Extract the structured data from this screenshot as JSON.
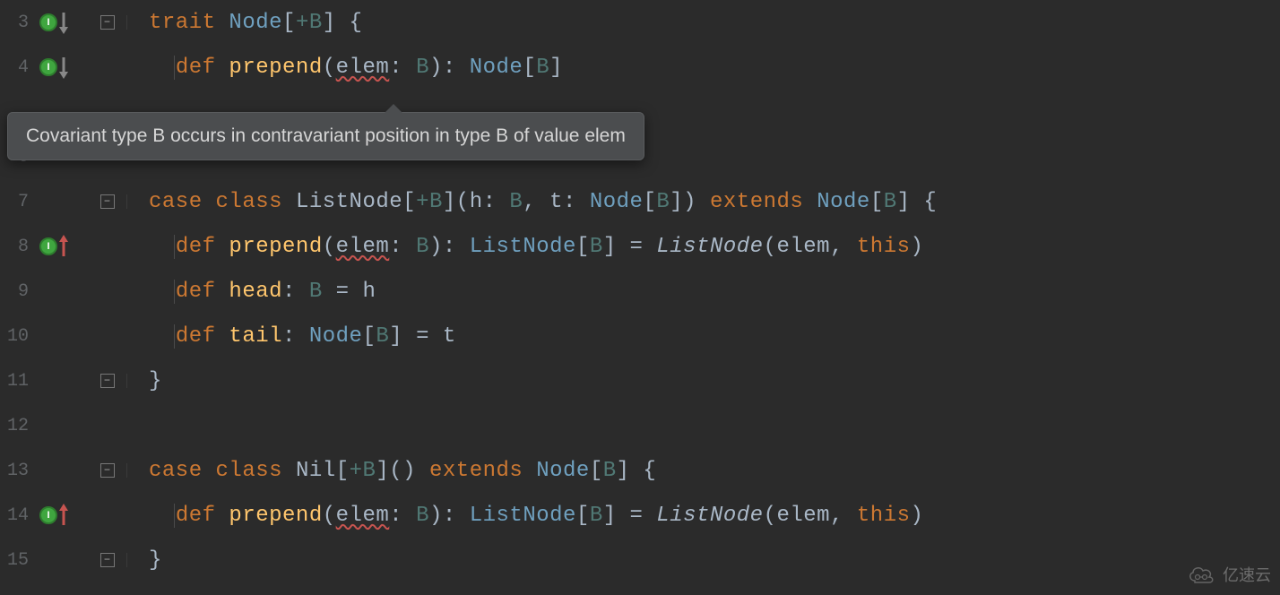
{
  "tooltip": {
    "text": "Covariant type B occurs in contravariant position in type B of value elem"
  },
  "lines": [
    {
      "num": "3",
      "icon": "impl-down",
      "fold": "open",
      "code": {
        "segments": [
          {
            "t": "trait ",
            "c": "kw"
          },
          {
            "t": "Node",
            "c": "ty"
          },
          {
            "t": "[",
            "c": "par"
          },
          {
            "t": "+B",
            "c": "tv"
          },
          {
            "t": "] {",
            "c": "par"
          }
        ]
      },
      "indent": 0
    },
    {
      "num": "4",
      "icon": "impl-down",
      "fold": "",
      "code": {
        "segments": [
          {
            "t": "  ",
            "c": ""
          },
          {
            "t": "def ",
            "c": "kw"
          },
          {
            "t": "prepend",
            "c": "fn"
          },
          {
            "t": "(",
            "c": "par"
          },
          {
            "t": "elem",
            "c": "id",
            "err": true
          },
          {
            "t": ": ",
            "c": "par"
          },
          {
            "t": "B",
            "c": "tv"
          },
          {
            "t": "): ",
            "c": "par"
          },
          {
            "t": "Node",
            "c": "ty"
          },
          {
            "t": "[",
            "c": "par"
          },
          {
            "t": "B",
            "c": "tv"
          },
          {
            "t": "]",
            "c": "par"
          }
        ]
      },
      "indent": 1
    },
    {
      "num": "",
      "icon": "",
      "fold": "",
      "code": {
        "segments": []
      },
      "indent": 0,
      "hidden": true
    },
    {
      "num": "6",
      "icon": "",
      "fold": "",
      "code": {
        "segments": []
      },
      "indent": 0
    },
    {
      "num": "7",
      "icon": "",
      "fold": "open",
      "code": {
        "segments": [
          {
            "t": "case class ",
            "c": "kw"
          },
          {
            "t": "ListNode",
            "c": "cls"
          },
          {
            "t": "[",
            "c": "par"
          },
          {
            "t": "+B",
            "c": "tv"
          },
          {
            "t": "](",
            "c": "par"
          },
          {
            "t": "h",
            "c": "id"
          },
          {
            "t": ": ",
            "c": "par"
          },
          {
            "t": "B",
            "c": "tv"
          },
          {
            "t": ", ",
            "c": "par"
          },
          {
            "t": "t",
            "c": "id"
          },
          {
            "t": ": ",
            "c": "par"
          },
          {
            "t": "Node",
            "c": "ty"
          },
          {
            "t": "[",
            "c": "par"
          },
          {
            "t": "B",
            "c": "tv"
          },
          {
            "t": "]) ",
            "c": "par"
          },
          {
            "t": "extends ",
            "c": "kw"
          },
          {
            "t": "Node",
            "c": "ty"
          },
          {
            "t": "[",
            "c": "par"
          },
          {
            "t": "B",
            "c": "tv"
          },
          {
            "t": "] {",
            "c": "par"
          }
        ]
      },
      "indent": 0
    },
    {
      "num": "8",
      "icon": "impl-up",
      "fold": "",
      "code": {
        "segments": [
          {
            "t": "  ",
            "c": ""
          },
          {
            "t": "def ",
            "c": "kw"
          },
          {
            "t": "prepend",
            "c": "fn"
          },
          {
            "t": "(",
            "c": "par"
          },
          {
            "t": "elem",
            "c": "id",
            "err": true
          },
          {
            "t": ": ",
            "c": "par"
          },
          {
            "t": "B",
            "c": "tv"
          },
          {
            "t": "): ",
            "c": "par"
          },
          {
            "t": "ListNode",
            "c": "ty"
          },
          {
            "t": "[",
            "c": "par"
          },
          {
            "t": "B",
            "c": "tv"
          },
          {
            "t": "] = ",
            "c": "par"
          },
          {
            "t": "ListNode",
            "c": "it"
          },
          {
            "t": "(elem, ",
            "c": "par"
          },
          {
            "t": "this",
            "c": "kw"
          },
          {
            "t": ")",
            "c": "par"
          }
        ]
      },
      "indent": 1
    },
    {
      "num": "9",
      "icon": "",
      "fold": "",
      "code": {
        "segments": [
          {
            "t": "  ",
            "c": ""
          },
          {
            "t": "def ",
            "c": "kw"
          },
          {
            "t": "head",
            "c": "fn"
          },
          {
            "t": ": ",
            "c": "par"
          },
          {
            "t": "B",
            "c": "tv"
          },
          {
            "t": " = h",
            "c": "par"
          }
        ]
      },
      "indent": 1
    },
    {
      "num": "10",
      "icon": "",
      "fold": "",
      "code": {
        "segments": [
          {
            "t": "  ",
            "c": ""
          },
          {
            "t": "def ",
            "c": "kw"
          },
          {
            "t": "tail",
            "c": "fn"
          },
          {
            "t": ": ",
            "c": "par"
          },
          {
            "t": "Node",
            "c": "ty"
          },
          {
            "t": "[",
            "c": "par"
          },
          {
            "t": "B",
            "c": "tv"
          },
          {
            "t": "] = t",
            "c": "par"
          }
        ]
      },
      "indent": 1
    },
    {
      "num": "11",
      "icon": "",
      "fold": "close",
      "code": {
        "segments": [
          {
            "t": "}",
            "c": "par"
          }
        ]
      },
      "indent": 0
    },
    {
      "num": "12",
      "icon": "",
      "fold": "",
      "code": {
        "segments": []
      },
      "indent": 0
    },
    {
      "num": "13",
      "icon": "",
      "fold": "open",
      "code": {
        "segments": [
          {
            "t": "case class ",
            "c": "kw"
          },
          {
            "t": "Nil",
            "c": "cls"
          },
          {
            "t": "[",
            "c": "par"
          },
          {
            "t": "+B",
            "c": "tv"
          },
          {
            "t": "]() ",
            "c": "par"
          },
          {
            "t": "extends ",
            "c": "kw"
          },
          {
            "t": "Node",
            "c": "ty"
          },
          {
            "t": "[",
            "c": "par"
          },
          {
            "t": "B",
            "c": "tv"
          },
          {
            "t": "] {",
            "c": "par"
          }
        ]
      },
      "indent": 0
    },
    {
      "num": "14",
      "icon": "impl-up",
      "fold": "",
      "code": {
        "segments": [
          {
            "t": "  ",
            "c": ""
          },
          {
            "t": "def ",
            "c": "kw"
          },
          {
            "t": "prepend",
            "c": "fn"
          },
          {
            "t": "(",
            "c": "par"
          },
          {
            "t": "elem",
            "c": "id",
            "err": true
          },
          {
            "t": ": ",
            "c": "par"
          },
          {
            "t": "B",
            "c": "tv"
          },
          {
            "t": "): ",
            "c": "par"
          },
          {
            "t": "ListNode",
            "c": "ty"
          },
          {
            "t": "[",
            "c": "par"
          },
          {
            "t": "B",
            "c": "tv"
          },
          {
            "t": "] = ",
            "c": "par"
          },
          {
            "t": "ListNode",
            "c": "it"
          },
          {
            "t": "(elem, ",
            "c": "par"
          },
          {
            "t": "this",
            "c": "kw"
          },
          {
            "t": ")",
            "c": "par"
          }
        ]
      },
      "indent": 1
    },
    {
      "num": "15",
      "icon": "",
      "fold": "close",
      "code": {
        "segments": [
          {
            "t": "}",
            "c": "par"
          }
        ]
      },
      "indent": 0
    }
  ],
  "watermark": {
    "text": "亿速云"
  }
}
